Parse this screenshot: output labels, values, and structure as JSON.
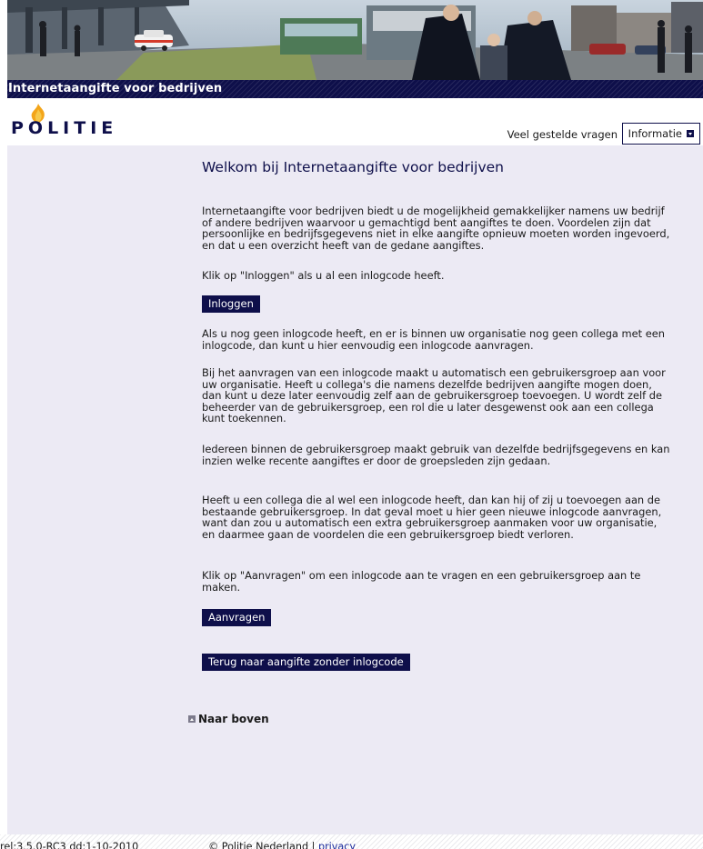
{
  "header": {
    "title": "Internetaangifte voor bedrijven",
    "logo_text": "POLITIE"
  },
  "nav": {
    "faq": "Veel gestelde vragen",
    "info": "Informatie"
  },
  "main": {
    "title": "Welkom bij Internetaangifte voor bedrijven",
    "intro": "Internetaangifte voor bedrijven biedt u de mogelijkheid gemakkelijker namens uw bedrijf of andere bedrijven waarvoor u gemachtigd bent aangiftes te doen. Voordelen zijn dat persoonlijke en bedrijfsgegevens niet in elke aangifte opnieuw moeten worden ingevoerd, en dat u een overzicht heeft van de gedane aangiftes.",
    "login_hint": "Klik op \"Inloggen\" als u al een inlogcode heeft.",
    "login_button": "Inloggen",
    "no_code": "Als u nog geen inlogcode heeft, en er is binnen uw organisatie nog geen collega met een inlogcode, dan kunt u hier eenvoudig een inlogcode aanvragen.",
    "group_info": "Bij het aanvragen van een inlogcode maakt u automatisch een gebruikersgroep aan voor uw organisatie. Heeft u collega's die namens dezelfde bedrijven aangifte mogen doen, dan kunt u deze later eenvoudig zelf aan de gebruikersgroep toevoegen. U wordt zelf de beheerder van de gebruikersgroep, een rol die u later desgewenst ook aan een collega kunt toekennen.",
    "shared_data": "Iedereen binnen de gebruikersgroep maakt gebruik van dezelfde bedrijfsgegevens en kan inzien welke recente aangiftes er door de groepsleden zijn gedaan.",
    "colleague": "Heeft u een collega die al wel een inlogcode heeft, dan kan hij of zij u toevoegen aan de bestaande gebruikersgroep. In dat geval moet u hier geen nieuwe inlogcode aanvragen, want dan zou u automatisch een extra gebruikersgroep aanmaken voor uw organisatie, en daarmee gaan de voordelen die een gebruikersgroep biedt verloren.",
    "request_hint": "Klik op \"Aanvragen\" om een inlogcode aan te vragen en een gebruikersgroep aan te maken.",
    "request_button": "Aanvragen",
    "back_button": "Terug naar aangifte zonder inlogcode",
    "to_top": "Naar boven"
  },
  "footer": {
    "release": "rel:3.5.0-RC3 dd:1-10-2010",
    "copyright": "© Politie Nederland |",
    "privacy": "privacy"
  },
  "colors": {
    "brand_navy": "#0e0f4a",
    "content_bg": "#eceaf4",
    "link_blue": "#1c2b9c"
  }
}
